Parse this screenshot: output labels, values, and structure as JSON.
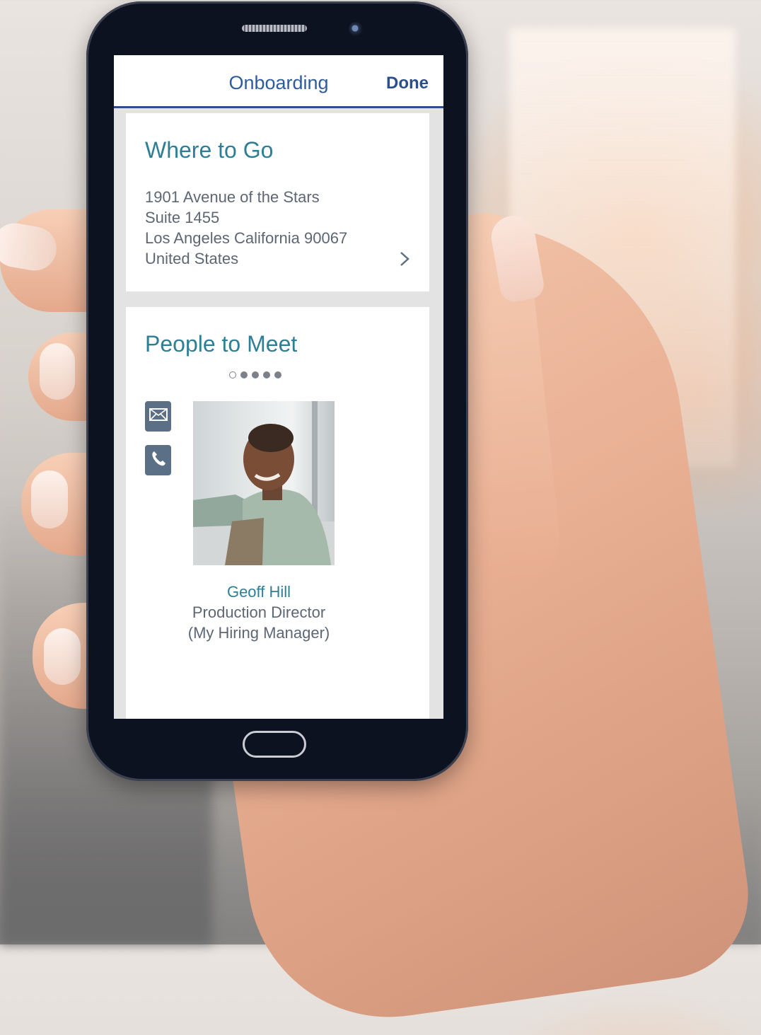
{
  "navbar": {
    "title": "Onboarding",
    "done_label": "Done"
  },
  "where_to_go": {
    "title": "Where to Go",
    "address": [
      "1901 Avenue of the Stars",
      "Suite 1455",
      "Los Angeles California 90067",
      "United States"
    ],
    "chevron_icon": "chevron-right-icon"
  },
  "people_to_meet": {
    "title": "People to Meet",
    "pager": {
      "pages": 5,
      "active_index": 0
    },
    "actions": {
      "email_icon": "mail-icon",
      "phone_icon": "phone-icon"
    },
    "person": {
      "name": "Geoff Hill",
      "role": "Production Director",
      "relation": "(My Hiring Manager)"
    }
  },
  "colors": {
    "heading_teal": "#2e7f96",
    "nav_blue": "#2f5c9b",
    "body_text": "#5d6774",
    "icon_slate": "#5b6f86",
    "phone_body": "#0d1220"
  }
}
